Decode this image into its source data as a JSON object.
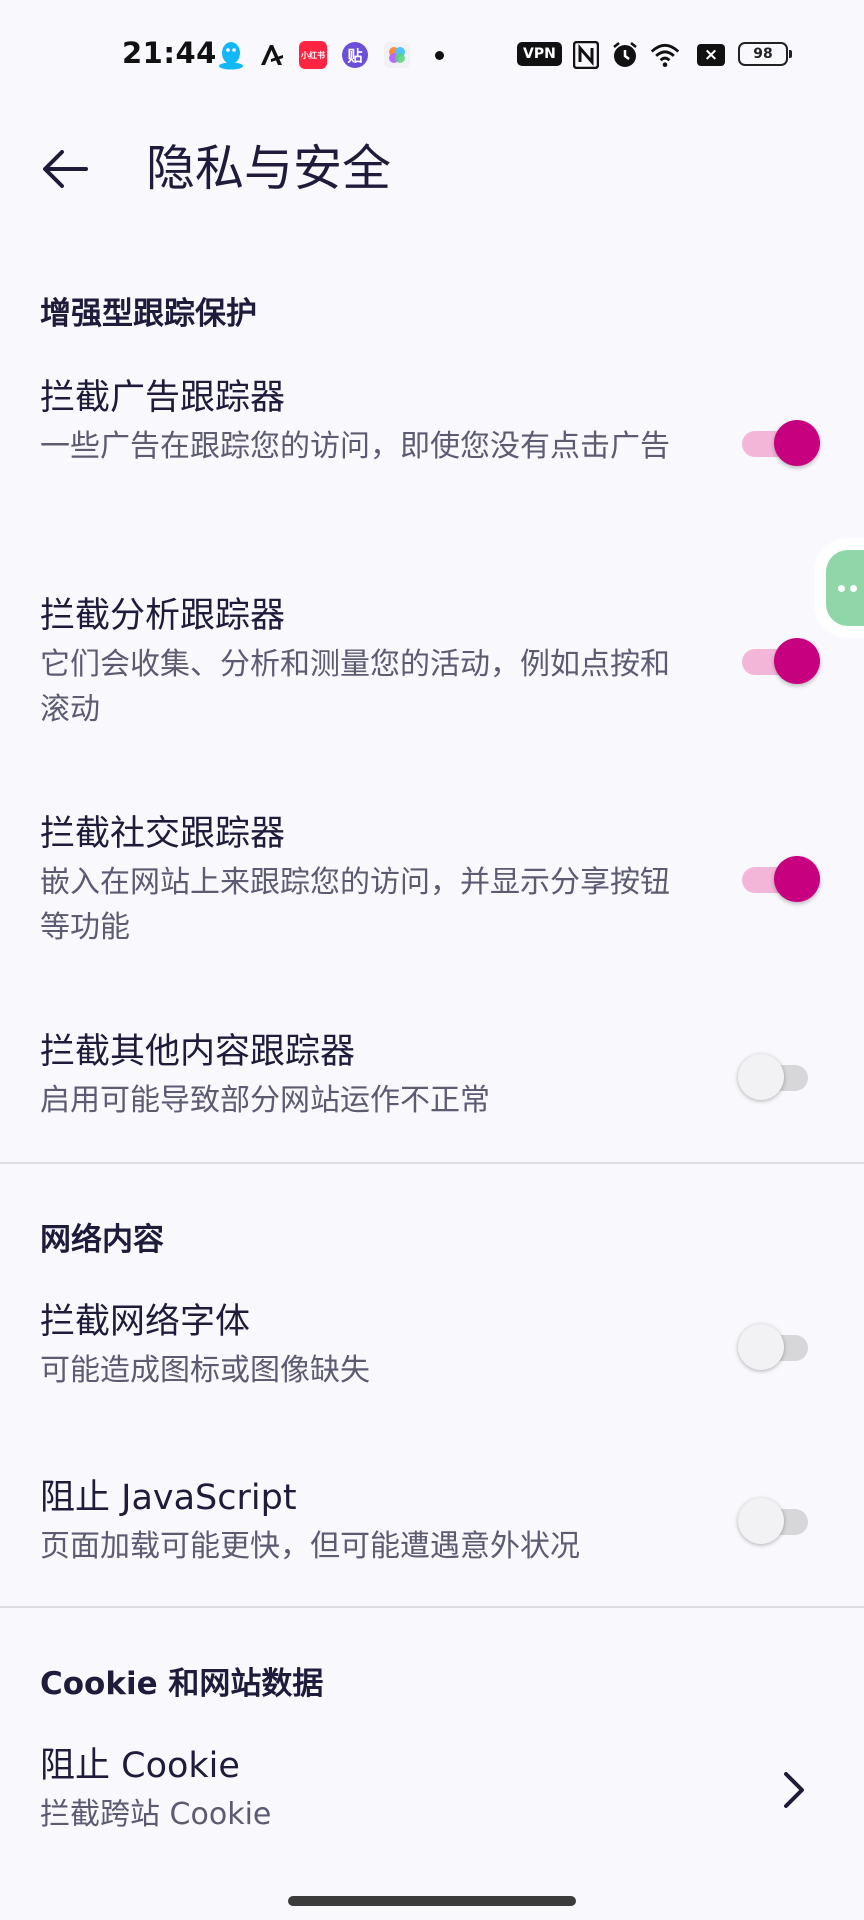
{
  "status_bar": {
    "time": "21:44",
    "vpn_label": "VPN",
    "battery_level": "98",
    "icons": [
      "qq-icon",
      "app-a-icon",
      "xiaohongshu-icon",
      "tieba-icon",
      "flower-app-icon",
      "notification-dot-icon",
      "nfc-icon",
      "alarm-icon",
      "wifi-icon",
      "data-off-icon",
      "battery-icon"
    ],
    "xiaohongshu_label": "小红书",
    "tieba_label": "贴"
  },
  "app_bar": {
    "title": "隐私与安全"
  },
  "sections": {
    "tracking": {
      "header": "增强型跟踪保护",
      "items": [
        {
          "title": "拦截广告跟踪器",
          "subtitle": "一些广告在跟踪您的访问，即使您没有点击广告",
          "enabled": true
        },
        {
          "title": "拦截分析跟踪器",
          "subtitle": "它们会收集、分析和测量您的活动，例如点按和滚动",
          "enabled": true
        },
        {
          "title": "拦截社交跟踪器",
          "subtitle": "嵌入在网站上来跟踪您的访问，并显示分享按钮等功能",
          "enabled": true
        },
        {
          "title": "拦截其他内容跟踪器",
          "subtitle": "启用可能导致部分网站运作不正常",
          "enabled": false
        }
      ]
    },
    "web_content": {
      "header": "网络内容",
      "items": [
        {
          "title": "拦截网络字体",
          "subtitle": "可能造成图标或图像缺失",
          "enabled": false
        },
        {
          "title": "阻止 JavaScript",
          "subtitle": "页面加载可能更快，但可能遭遇意外状况",
          "enabled": false
        }
      ]
    },
    "cookies": {
      "header": "Cookie 和网站数据",
      "items": [
        {
          "title": "阻止 Cookie",
          "subtitle": "拦截跨站 Cookie"
        }
      ]
    }
  },
  "colors": {
    "accent": "#c7007f",
    "accent_track": "#f3b6d9",
    "background": "#f9f9fd",
    "text_primary": "#1e1c3a",
    "text_secondary": "#5d5b72"
  }
}
